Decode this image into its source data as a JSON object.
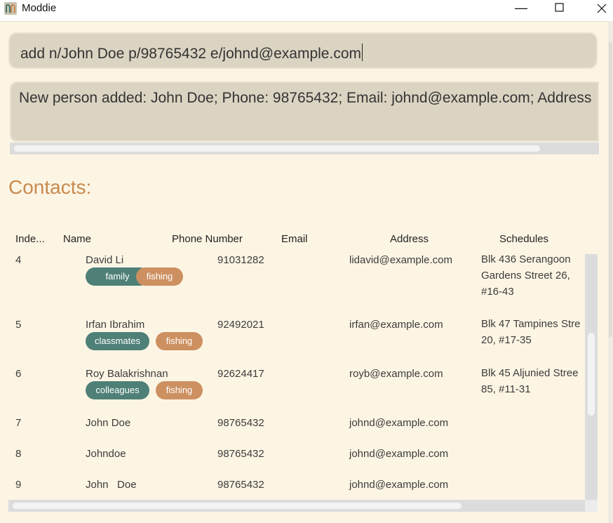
{
  "window": {
    "title": "Moddie",
    "minimize_glyph": "—",
    "maximize_icon": "square-icon",
    "close_icon": "close-icon"
  },
  "command": {
    "value": "add n/John Doe p/98765432 e/johnd@example.com"
  },
  "result": {
    "text": "New person added: John  Doe; Phone: 98765432; Email: johnd@example.com; Address"
  },
  "contacts": {
    "heading": "Contacts:",
    "columns": {
      "index": "Inde...",
      "name": "Name",
      "phone": "Phone Number",
      "email": "Email",
      "address": "Address",
      "schedules": "Schedules"
    },
    "rows": [
      {
        "index": "4",
        "name": "David Li",
        "phone": "91031282",
        "email": "lidavid@example.com",
        "address": "Blk 436 Serangoon Gardens Street 26, #16-43",
        "tags": [
          "family",
          "fishing"
        ]
      },
      {
        "index": "5",
        "name": "Irfan Ibrahim",
        "phone": "92492021",
        "email": "irfan@example.com",
        "address": "Blk 47 Tampines Stre 20, #17-35",
        "tags": [
          "classmates",
          "fishing"
        ]
      },
      {
        "index": "6",
        "name": "Roy Balakrishnan",
        "phone": "92624417",
        "email": "royb@example.com",
        "address": "Blk 45 Aljunied Stree 85, #11-31",
        "tags": [
          "colleagues",
          "fishing"
        ]
      },
      {
        "index": "7",
        "name": "John Doe",
        "phone": "98765432",
        "email": "johnd@example.com",
        "address": "",
        "tags": []
      },
      {
        "index": "8",
        "name": "Johndoe",
        "phone": "98765432",
        "email": "johnd@example.com",
        "address": "",
        "tags": []
      },
      {
        "index": "9",
        "name": "John   Doe",
        "phone": "98765432",
        "email": "johnd@example.com",
        "address": "",
        "tags": []
      }
    ]
  },
  "colors": {
    "background": "#fdf5e4",
    "input_bg": "#dbd4c2",
    "heading": "#c78a4f",
    "tag_teal": "#4e8077",
    "tag_orange": "#cd9061"
  }
}
